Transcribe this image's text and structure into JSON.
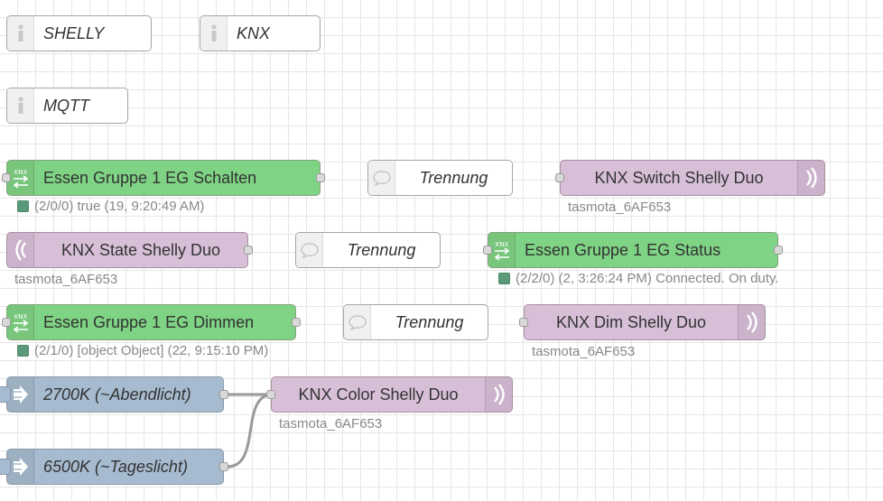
{
  "nodes": {
    "shelly": {
      "label": "SHELLY",
      "icon": "info-icon"
    },
    "knx": {
      "label": "KNX",
      "icon": "info-icon"
    },
    "mqtt": {
      "label": "MQTT",
      "icon": "info-icon"
    },
    "essen_schalten": {
      "label": "Essen Gruppe 1 EG Schalten",
      "status": "(2/0/0) true (19, 9:20:49 AM)",
      "icon": "knx-icon"
    },
    "trennung1": {
      "label": "Trennung",
      "icon": "comment-icon"
    },
    "knx_switch": {
      "label": "KNX Switch Shelly Duo",
      "sub": "tasmota_6AF653",
      "icon": "wireless-icon"
    },
    "knx_state": {
      "label": "KNX State Shelly Duo",
      "sub": "tasmota_6AF653",
      "icon": "wireless-icon"
    },
    "trennung2": {
      "label": "Trennung",
      "icon": "comment-icon"
    },
    "essen_status": {
      "label": "Essen Gruppe 1 EG Status",
      "status": "(2/2/0) (2, 3:26:24 PM) Connected. On duty.",
      "icon": "knx-icon"
    },
    "essen_dimmen": {
      "label": "Essen Gruppe 1 EG Dimmen",
      "status": "(2/1/0) [object Object] (22, 9:15:10 PM)",
      "icon": "knx-icon"
    },
    "trennung3": {
      "label": "Trennung",
      "icon": "comment-icon"
    },
    "knx_dim": {
      "label": "KNX Dim Shelly Duo",
      "sub": "tasmota_6AF653",
      "icon": "wireless-icon"
    },
    "inject_2700": {
      "label": "2700K (~Abendlicht)",
      "icon": "arrow-right-icon"
    },
    "knx_color": {
      "label": "KNX Color Shelly Duo",
      "sub": "tasmota_6AF653",
      "icon": "wireless-icon"
    },
    "inject_6500": {
      "label": "6500K (~Tageslicht)",
      "icon": "arrow-right-icon"
    }
  },
  "colors": {
    "knx_node": "#7fd384",
    "mqtt_node": "#d8bfd8",
    "inject_node": "#a6bbcf",
    "status_dot": "#5a9a7a",
    "wire": "#999999"
  }
}
